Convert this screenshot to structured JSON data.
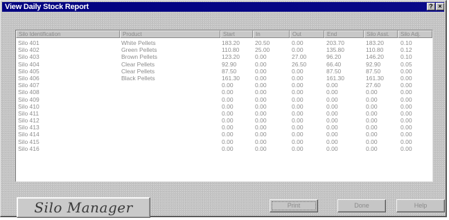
{
  "window": {
    "title": "View Daily Stock Report",
    "help_glyph": "?",
    "close_glyph": "×"
  },
  "columns": [
    "Silo Identification",
    "Product",
    "Start",
    "In",
    "Out",
    "End",
    "Silo Asst.",
    "Silo Adj."
  ],
  "rows": [
    [
      "Silo 401",
      "White Pellets",
      "183.20",
      "20.50",
      "0.00",
      "203.70",
      "183.20",
      "0.10"
    ],
    [
      "Silo 402",
      "Green Pellets",
      "110.80",
      "25.00",
      "0.00",
      "135.80",
      "110.80",
      "0.12"
    ],
    [
      "Silo 403",
      "Brown Pellets",
      "123.20",
      "0.00",
      "27.00",
      "96.20",
      "146.20",
      "0.10"
    ],
    [
      "Silo 404",
      "Clear Pellets",
      "92.90",
      "0.00",
      "26.50",
      "66.40",
      "92.90",
      "0.05"
    ],
    [
      "Silo 405",
      "Clear Pellets",
      "87.50",
      "0.00",
      "0.00",
      "87.50",
      "87.50",
      "0.00"
    ],
    [
      "Silo 406",
      "Black Pellets",
      "161.30",
      "0.00",
      "0.00",
      "161.30",
      "161.30",
      "0.00"
    ],
    [
      "Silo 407",
      "",
      "0.00",
      "0.00",
      "0.00",
      "0.00",
      "27.60",
      "0.00"
    ],
    [
      "Silo 408",
      "",
      "0.00",
      "0.00",
      "0.00",
      "0.00",
      "0.00",
      "0.00"
    ],
    [
      "Silo 409",
      "",
      "0.00",
      "0.00",
      "0.00",
      "0.00",
      "0.00",
      "0.00"
    ],
    [
      "Silo 410",
      "",
      "0.00",
      "0.00",
      "0.00",
      "0.00",
      "0.00",
      "0.00"
    ],
    [
      "Silo 411",
      "",
      "0.00",
      "0.00",
      "0.00",
      "0.00",
      "0.00",
      "0.00"
    ],
    [
      "Silo 412",
      "",
      "0.00",
      "0.00",
      "0.00",
      "0.00",
      "0.00",
      "0.00"
    ],
    [
      "Silo 413",
      "",
      "0.00",
      "0.00",
      "0.00",
      "0.00",
      "0.00",
      "0.00"
    ],
    [
      "Silo 414",
      "",
      "0.00",
      "0.00",
      "0.00",
      "0.00",
      "0.00",
      "0.00"
    ],
    [
      "Silo 415",
      "",
      "0.00",
      "0.00",
      "0.00",
      "0.00",
      "0.00",
      "0.00"
    ],
    [
      "Silo 416",
      "",
      "0.00",
      "0.00",
      "0.00",
      "0.00",
      "0.00",
      "0.00"
    ]
  ],
  "logo_text": "Silo Manager",
  "buttons": {
    "print": "Print",
    "done": "Done",
    "help": "Help"
  }
}
